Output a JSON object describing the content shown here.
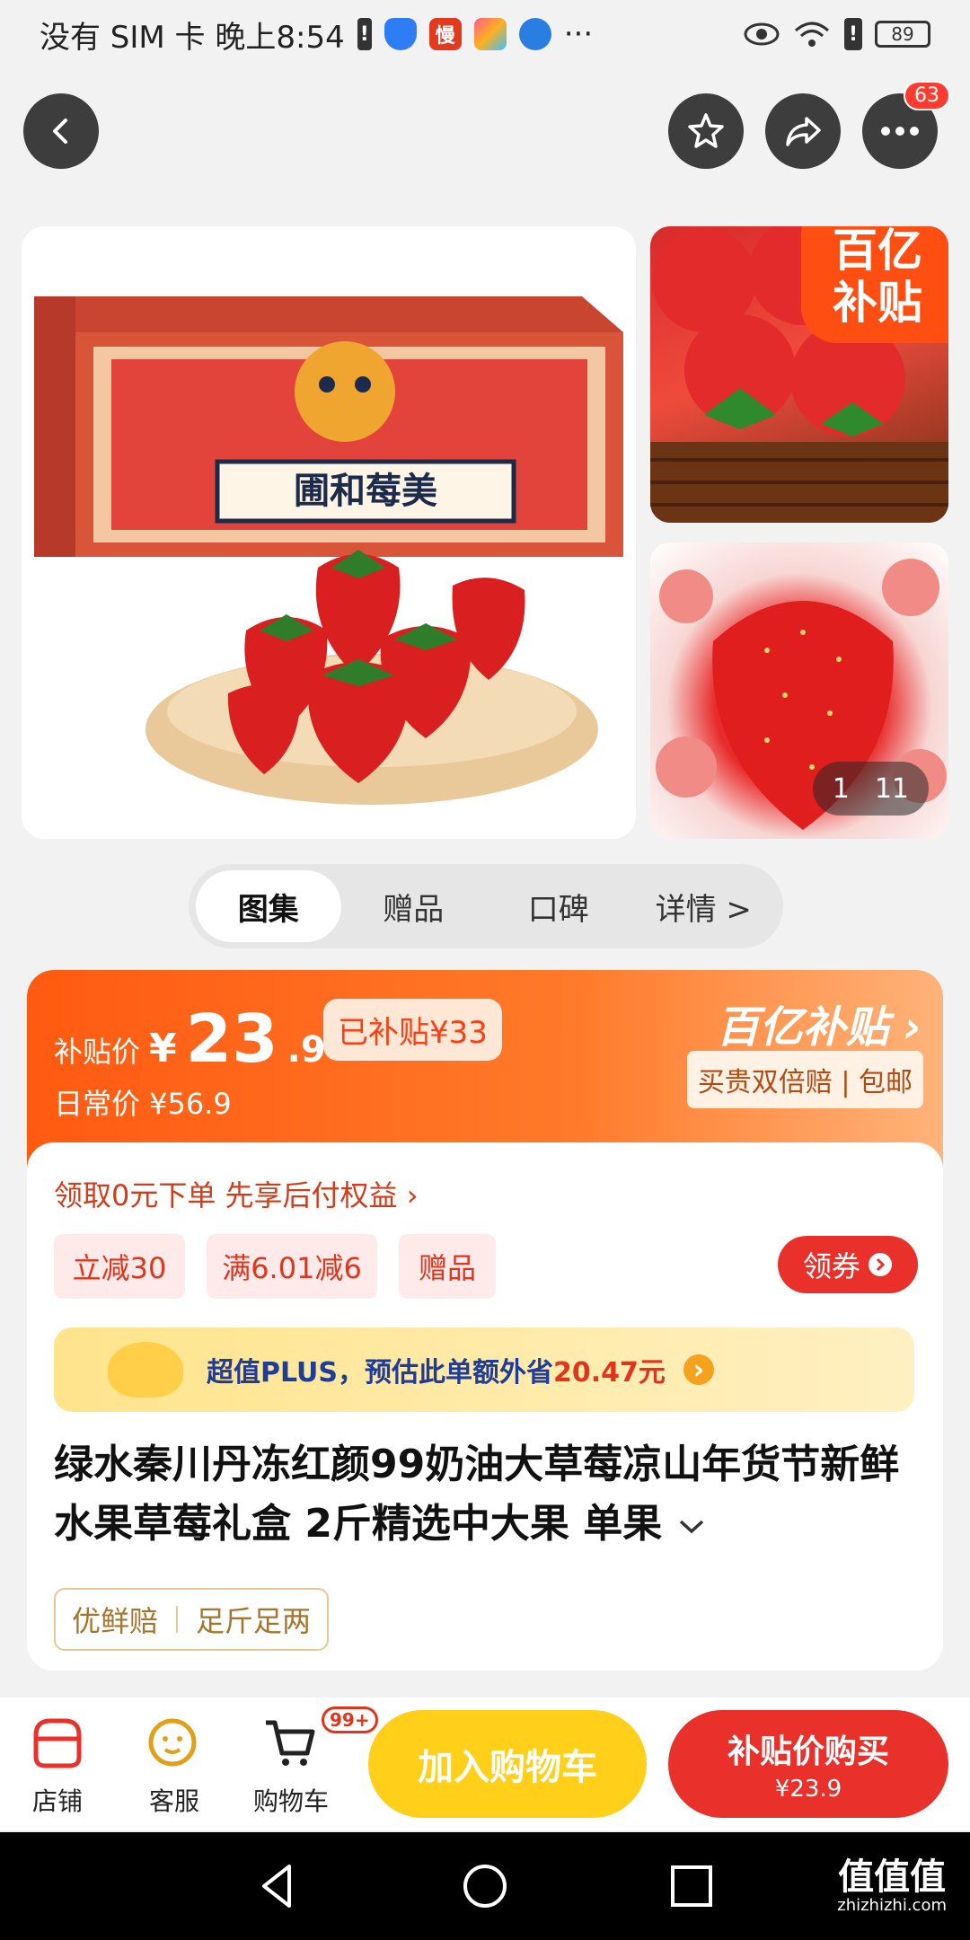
{
  "status_bar": {
    "carrier_time": "没有 SIM 卡 晚上8:54",
    "more_dots": "···",
    "battery": "89"
  },
  "top_nav": {
    "more_badge": "63"
  },
  "gallery": {
    "corner_badge_line1": "百亿",
    "corner_badge_line2": "补贴",
    "counter_current": "1",
    "counter_total": "11"
  },
  "tabs": [
    {
      "label": "图集",
      "active": true
    },
    {
      "label": "赠品",
      "active": false
    },
    {
      "label": "口碑",
      "active": false
    },
    {
      "label": "详情 >",
      "active": false
    }
  ],
  "price": {
    "subsidy_label": "补贴价",
    "currency": "¥",
    "integer": "23",
    "decimal": ".9",
    "subsidized_tag": "已补贴¥33",
    "normal_label": "日常价 ¥56.9",
    "program_title": "百亿补贴",
    "program_arrow": "›",
    "program_promise": "买贵双倍赔 | 包邮"
  },
  "offers": {
    "pay_later": "领取0元下单 先享后付权益 ›",
    "chips": [
      "立减30",
      "满6.01减6",
      "赠品"
    ],
    "coupon_button": "领券"
  },
  "plus_bar": {
    "text_prefix": "超值PLUS，预估此单额外省",
    "amount": "20.47元",
    "arrow": "›"
  },
  "product": {
    "title": "绿水秦川丹冻红颜99奶油大草莓凉山年货节新鲜水果草莓礼盒 2斤精选中大果  单果",
    "expand_icon": "chevron-down"
  },
  "guarantees": [
    "优鲜赔",
    "足斤足两"
  ],
  "action_bar": {
    "store": "店铺",
    "service": "客服",
    "cart": "购物车",
    "cart_badge": "99+",
    "add_to_cart": "加入购物车",
    "buy_line1": "补贴价购买",
    "buy_line2": "¥23.9"
  },
  "watermark": {
    "brand": "值值值",
    "domain": "zhizhizhi.com"
  },
  "colors": {
    "brand_red": "#e9302a",
    "subsidy_orange": "#ff5a11",
    "cart_yellow": "#ffcf1a",
    "plus_blue": "#1e3c9a"
  }
}
